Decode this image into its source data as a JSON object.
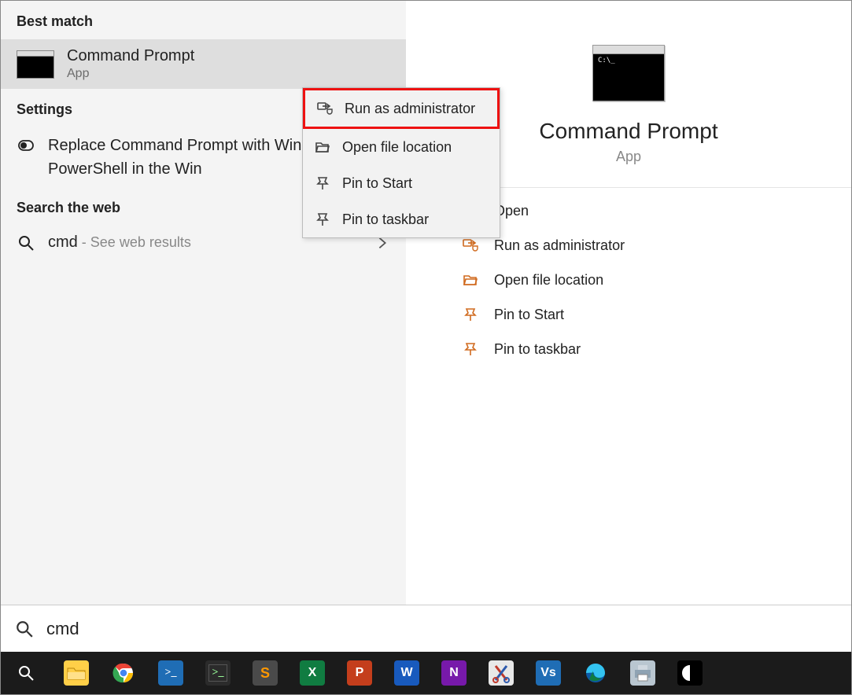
{
  "left": {
    "best_match_header": "Best match",
    "best_match": {
      "title": "Command Prompt",
      "subtitle": "App"
    },
    "settings_header": "Settings",
    "settings_item": "Replace Command Prompt with Windows PowerShell in the Win",
    "web_header": "Search the web",
    "web_query": "cmd",
    "web_suffix": " - See web results"
  },
  "context_menu": {
    "items": [
      {
        "label": "Run as administrator",
        "icon": "shield-arrow-icon",
        "highlight": true
      },
      {
        "label": "Open file location",
        "icon": "folder-open-icon"
      },
      {
        "label": "Pin to Start",
        "icon": "pin-icon"
      },
      {
        "label": "Pin to taskbar",
        "icon": "pin-icon"
      }
    ]
  },
  "right": {
    "title": "Command Prompt",
    "subtitle": "App",
    "actions": [
      {
        "label": "Open",
        "icon": "open-external-icon"
      },
      {
        "label": "Run as administrator",
        "icon": "shield-arrow-icon"
      },
      {
        "label": "Open file location",
        "icon": "folder-open-icon"
      },
      {
        "label": "Pin to Start",
        "icon": "pin-icon"
      },
      {
        "label": "Pin to taskbar",
        "icon": "pin-icon"
      }
    ]
  },
  "search": {
    "value": "cmd"
  },
  "taskbar": {
    "items": [
      {
        "name": "search-button",
        "bg": "transparent",
        "glyph": "search"
      },
      {
        "name": "file-explorer",
        "bg": "#ffcf48",
        "glyph": "folder"
      },
      {
        "name": "chrome",
        "bg": "transparent",
        "glyph": "chrome"
      },
      {
        "name": "powershell",
        "bg": "#1f6db5",
        "glyph": "ps"
      },
      {
        "name": "terminal",
        "bg": "#2b2b2b",
        "glyph": "term"
      },
      {
        "name": "sublime",
        "bg": "#4a4a4a",
        "glyph": "s"
      },
      {
        "name": "excel",
        "bg": "#107c41",
        "glyph": "X"
      },
      {
        "name": "powerpoint",
        "bg": "#c43e1c",
        "glyph": "P"
      },
      {
        "name": "word",
        "bg": "#185abd",
        "glyph": "W"
      },
      {
        "name": "onenote",
        "bg": "#7719aa",
        "glyph": "N"
      },
      {
        "name": "snip",
        "bg": "#e8e8e8",
        "glyph": "snip"
      },
      {
        "name": "vnc",
        "bg": "#1f6db5",
        "glyph": "Vs"
      },
      {
        "name": "edge",
        "bg": "transparent",
        "glyph": "edge"
      },
      {
        "name": "printer",
        "bg": "#b9c6d0",
        "glyph": "printer"
      },
      {
        "name": "app-unknown",
        "bg": "#000",
        "glyph": "circle"
      }
    ]
  }
}
